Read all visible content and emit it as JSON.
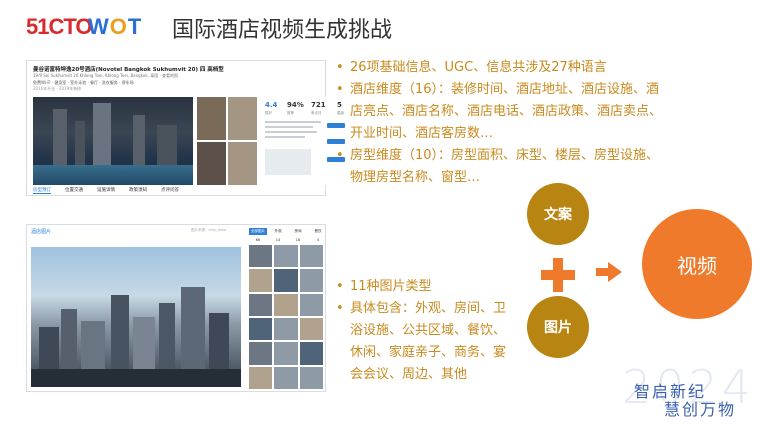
{
  "header": {
    "logo_51cto": "51CTO",
    "logo_wot_pre": "W",
    "logo_wot_o": "O",
    "logo_wot_post": "T",
    "title": "国际酒店视频生成挑战"
  },
  "hotel_page": {
    "name": "曼谷诺富特坤逸20号酒店(Novotel Bangkok Sukhumvit 20) 四 高档型",
    "address": "19/9 Soi Sukhumvit 20 Khlong Toei, Khlong Toei, Bangkok, 泰国 · 查看地图",
    "tags": "免费Wi-Fi · 健身室 · 室外泳池 · 餐厅 · 洗衣服务 · 停车场",
    "tags2": "2016年开业 · 2019年装修",
    "score": "4.4",
    "score_cap": "很好",
    "percent": "94%",
    "percent_cap": "推荐",
    "reviews": "721",
    "reviews_cap": "条点评",
    "five": "5",
    "five_cap": "星级",
    "gallery_label": "全部照片",
    "tabs": [
      "房型预订",
      "位置交通",
      "设施详情",
      "政策须知",
      "点评问答"
    ]
  },
  "image_page": {
    "label": "酒店图片",
    "source": "图片来源：ctrip_data",
    "tabs": [
      "全部图片",
      "外观",
      "房间",
      "餐饮"
    ],
    "tab_counts": [
      "66",
      "14",
      "18",
      "4"
    ]
  },
  "bullets_top": [
    "26项基础信息、UGC、信息共涉及27种语言",
    "酒店维度（16）：装修时间、酒店地址、酒店设施、酒店亮点、酒店名称、酒店电话、酒店政策、酒店卖点、开业时间、酒店客房数…",
    "房型维度（10）：房型面积、床型、楼层、房型设施、物理房型名称、窗型…"
  ],
  "bullets_bottom": [
    "11种图片类型",
    "具体包含：外观、房间、卫浴设施、公共区域、餐饮、休闲、家庭亲子、商务、宴会会议、周边、其他"
  ],
  "flow": {
    "text_label": "文案",
    "image_label": "图片",
    "video_label": "视频",
    "circle_color": "#b88512",
    "accent_color": "#ef7a2b"
  },
  "footer": {
    "slogan_line1": "智启新纪",
    "slogan_line2": "慧创万物",
    "year": "2024"
  }
}
